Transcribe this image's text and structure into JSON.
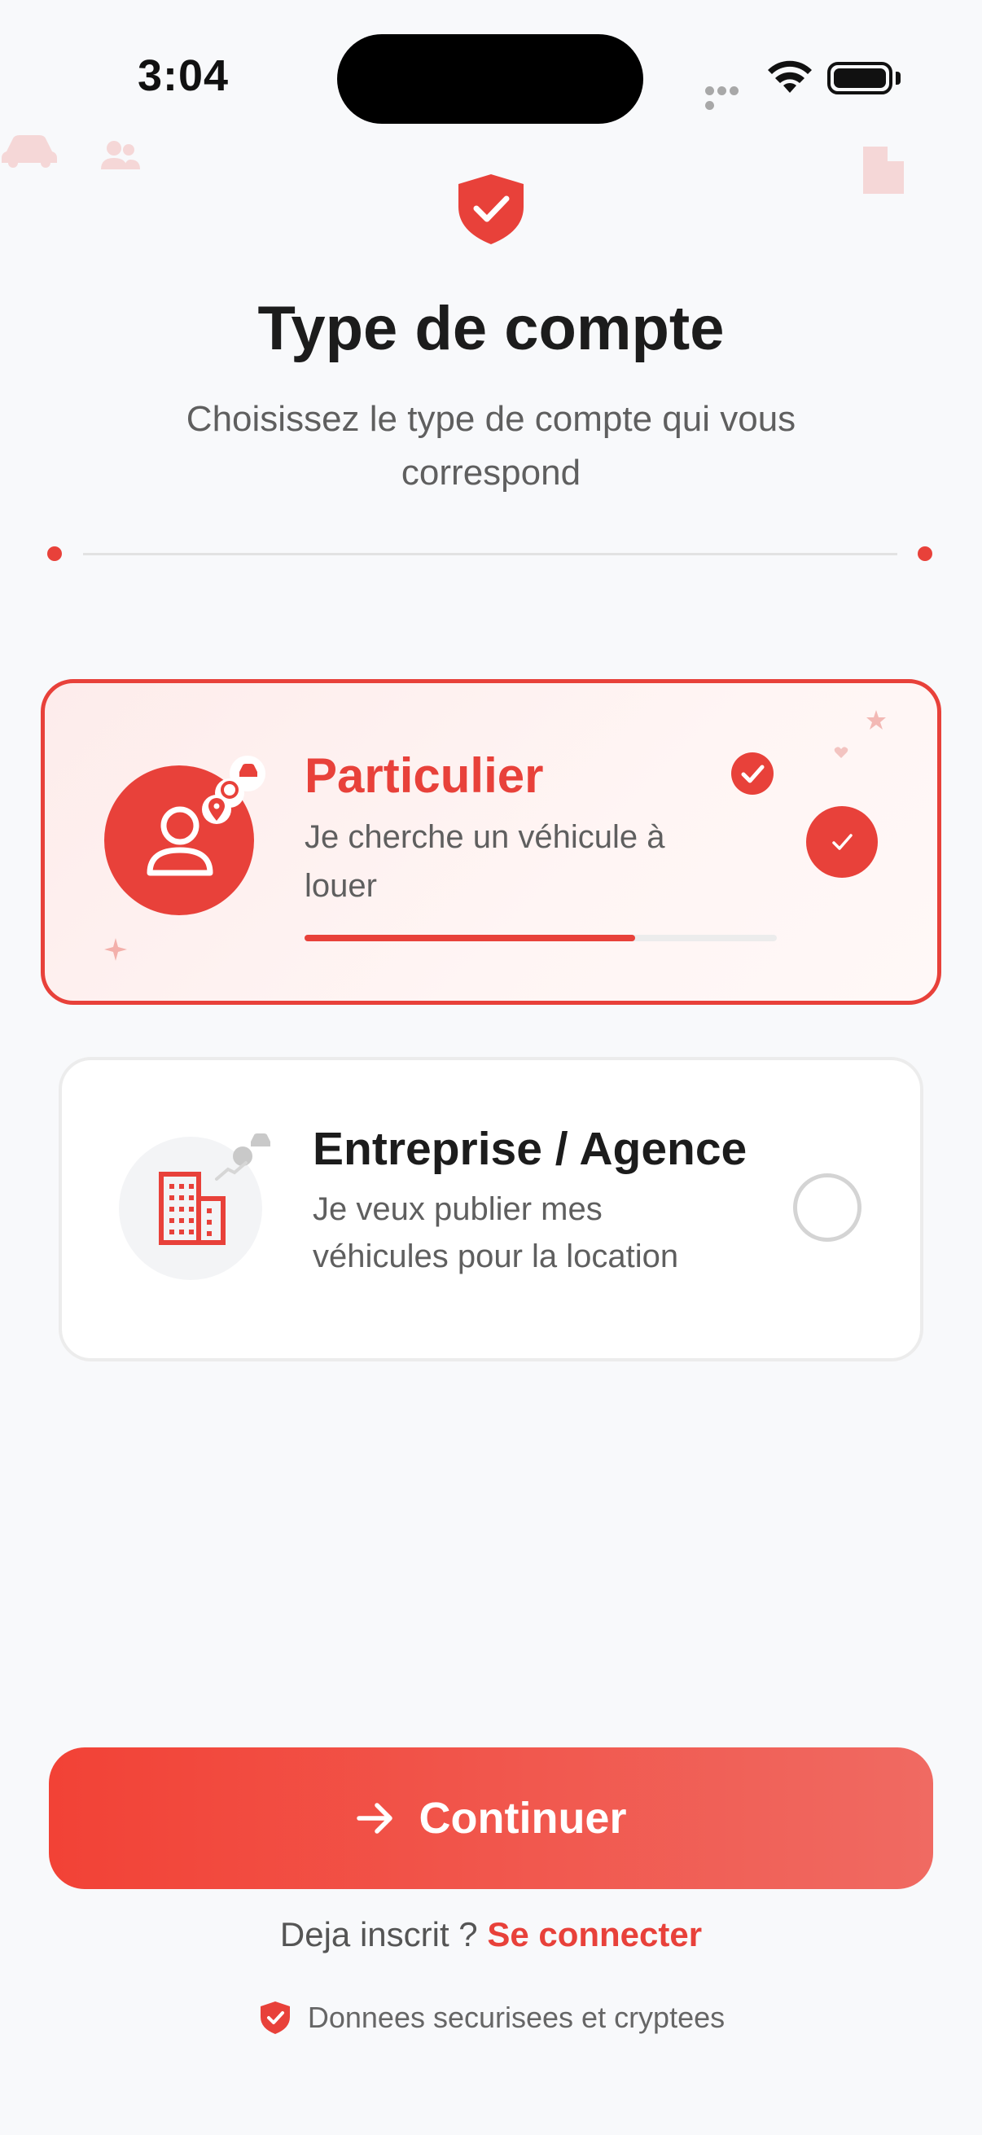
{
  "status_bar": {
    "time": "3:04"
  },
  "header": {
    "title": "Type de compte",
    "subtitle": "Choisissez le type de compte qui vous correspond"
  },
  "account_types": [
    {
      "title": "Particulier",
      "description": "Je cherche un véhicule à louer",
      "selected": true,
      "progress": 0.7
    },
    {
      "title": "Entreprise / Agence",
      "description": "Je veux publier mes véhicules pour la location",
      "selected": false
    }
  ],
  "actions": {
    "continue_label": "Continuer",
    "already_registered": "Deja inscrit ? ",
    "login_label": "Se connecter"
  },
  "footer": {
    "security_note": "Donnees securisees et cryptees"
  },
  "colors": {
    "accent": "#e8413a",
    "background": "#f8f9fb"
  },
  "icons": [
    "car-icon",
    "users-icon",
    "building-icon",
    "shield-check-icon",
    "user-icon",
    "arrow-right-icon",
    "check-icon"
  ]
}
